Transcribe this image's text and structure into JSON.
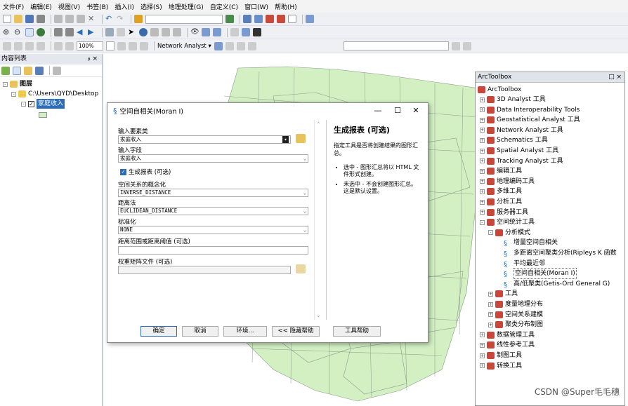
{
  "menu": [
    "文件(F)",
    "编辑(E)",
    "视图(V)",
    "书签(B)",
    "插入(I)",
    "选择(S)",
    "地理处理(G)",
    "自定义(C)",
    "窗口(W)",
    "帮助(H)"
  ],
  "toolbar": {
    "zoom": "100%",
    "network_analyst": "Network Analyst ▾"
  },
  "toc": {
    "title": "内容列表",
    "pin": "ᵦ ×",
    "root": "图层",
    "path": "C:\\Users\\QYD\\Desktop",
    "layer": "家庭收入"
  },
  "arctoolbox": {
    "title": "ArcToolbox",
    "controls": "□ ×",
    "root": "ArcToolbox",
    "items": [
      {
        "label": "3D Analyst 工具",
        "level": 1,
        "exp": "+"
      },
      {
        "label": "Data Interoperability Tools",
        "level": 1,
        "exp": "+"
      },
      {
        "label": "Geostatistical Analyst 工具",
        "level": 1,
        "exp": "+"
      },
      {
        "label": "Network Analyst 工具",
        "level": 1,
        "exp": "+"
      },
      {
        "label": "Schematics 工具",
        "level": 1,
        "exp": "+"
      },
      {
        "label": "Spatial Analyst 工具",
        "level": 1,
        "exp": "+"
      },
      {
        "label": "Tracking Analyst 工具",
        "level": 1,
        "exp": "+"
      },
      {
        "label": "编辑工具",
        "level": 1,
        "exp": "+"
      },
      {
        "label": "地理编码工具",
        "level": 1,
        "exp": "+"
      },
      {
        "label": "多维工具",
        "level": 1,
        "exp": "+"
      },
      {
        "label": "分析工具",
        "level": 1,
        "exp": "+"
      },
      {
        "label": "服务器工具",
        "level": 1,
        "exp": "+"
      },
      {
        "label": "空间统计工具",
        "level": 1,
        "exp": "-"
      },
      {
        "label": "分析模式",
        "level": 2,
        "exp": "-"
      },
      {
        "label": "增量空间自相关",
        "level": 3,
        "exp": ""
      },
      {
        "label": "多距离空间聚类分析(Ripleys K 函数",
        "level": 3,
        "exp": ""
      },
      {
        "label": "平均最近邻",
        "level": 3,
        "exp": ""
      },
      {
        "label": "空间自相关(Moran I)",
        "level": 3,
        "exp": "",
        "selected": true
      },
      {
        "label": "高/低聚类(Getis-Ord General G)",
        "level": 3,
        "exp": ""
      },
      {
        "label": "工具",
        "level": 2,
        "exp": "+"
      },
      {
        "label": "度量地理分布",
        "level": 2,
        "exp": "+"
      },
      {
        "label": "空间关系建模",
        "level": 2,
        "exp": "+"
      },
      {
        "label": "聚类分布制图",
        "level": 2,
        "exp": "+"
      },
      {
        "label": "数据管理工具",
        "level": 1,
        "exp": "+"
      },
      {
        "label": "线性参考工具",
        "level": 1,
        "exp": "+"
      },
      {
        "label": "制图工具",
        "level": 1,
        "exp": "+"
      },
      {
        "label": "转换工具",
        "level": 1,
        "exp": "+"
      }
    ]
  },
  "dialog": {
    "title": "空间自相关(Moran I)",
    "min": "—",
    "max": "☐",
    "close": "✕",
    "input_features_label": "输入要素类",
    "input_features_value": "家庭收入",
    "input_field_label": "输入字段",
    "input_field_value": "家庭收入",
    "report_label": "生成报表 (可选)",
    "concept_label": "空间关系的概念化",
    "concept_value": "INVERSE_DISTANCE",
    "distance_label": "距离法",
    "distance_value": "EUCLIDEAN_DISTANCE",
    "standard_label": "标准化",
    "standard_value": "NONE",
    "threshold_label": "距离范围或距离阈值 (可选)",
    "threshold_value": "",
    "weights_label": "权重矩阵文件 (可选)",
    "weights_value": "",
    "ok": "确定",
    "cancel": "取消",
    "env": "环境...",
    "hide_help": "<< 隐藏帮助",
    "tool_help": "工具帮助",
    "help_title": "生成报表 (可选)",
    "help_desc": "指定工具是否将创建结果的图形汇总。",
    "help_items": [
      "选中 - 图形汇总将以 HTML 文件形式创建。",
      "未选中 - 不会创建图形汇总。这是默认设置。"
    ]
  },
  "watermark": "CSDN @Super毛毛穗",
  "colors": {
    "polygon": "#d2f0c2",
    "outline": "#8a9a8a",
    "toolbox_red": "#c8473a",
    "accent": "#2a6ebb"
  }
}
